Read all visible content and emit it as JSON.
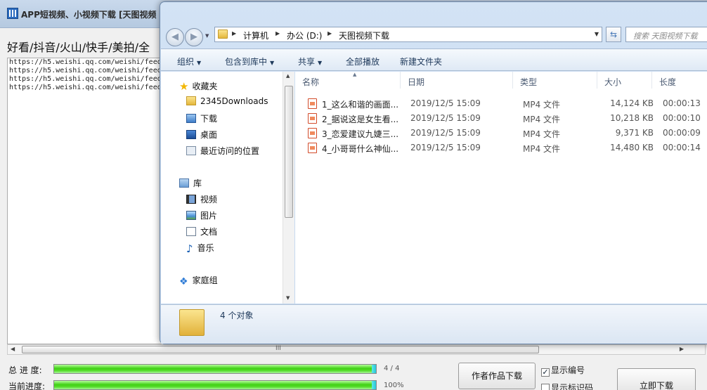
{
  "app": {
    "title": "APP短视频、小视频下载 [天图视频",
    "platforms": "好看/抖音/火山/快手/美拍/全",
    "urls": [
      "https://h5.weishi.qq.com/weishi/feed",
      "https://h5.weishi.qq.com/weishi/feed",
      "https://h5.weishi.qq.com/weishi/feed",
      "https://h5.weishi.qq.com/weishi/feed"
    ],
    "scroll_grip": "III",
    "total_label": "总 进 度:",
    "total_progress": 1.0,
    "total_text": "4 / 4",
    "current_label": "当前进度:",
    "current_progress": 1.0,
    "current_text": "100%",
    "author_button": "作者作品下载",
    "show_number_label": "显示编号",
    "show_number_checked": true,
    "show_marker_label": "显示标识码",
    "show_marker_checked": false,
    "download_button": "立即下载"
  },
  "explorer": {
    "breadcrumb": [
      "计算机",
      "办公 (D:)",
      "天图视频下载"
    ],
    "search_placeholder": "搜索 天图视频下载",
    "toolbar": [
      {
        "label": "组织",
        "dropdown": true
      },
      {
        "label": "包含到库中",
        "dropdown": true
      },
      {
        "label": "共享",
        "dropdown": true
      },
      {
        "label": "全部播放",
        "dropdown": false
      },
      {
        "label": "新建文件夹",
        "dropdown": false
      }
    ],
    "nav": {
      "favorites": "收藏夹",
      "fav_items": [
        "2345Downloads",
        "下载",
        "桌面",
        "最近访问的位置"
      ],
      "libraries": "库",
      "lib_items": [
        "视频",
        "图片",
        "文档",
        "音乐"
      ],
      "homegroup": "家庭组"
    },
    "columns": [
      "名称",
      "日期",
      "类型",
      "大小",
      "长度"
    ],
    "files": [
      {
        "name": "1_这么和谐的画面...",
        "date": "2019/12/5 15:09",
        "type": "MP4 文件",
        "size": "14,124 KB",
        "length": "00:00:13"
      },
      {
        "name": "2_据说这是女生看...",
        "date": "2019/12/5 15:09",
        "type": "MP4 文件",
        "size": "10,218 KB",
        "length": "00:00:10"
      },
      {
        "name": "3_恋爱建议九婕三...",
        "date": "2019/12/5 15:09",
        "type": "MP4 文件",
        "size": "9,371 KB",
        "length": "00:00:09"
      },
      {
        "name": "4_小哥哥什么神仙...",
        "date": "2019/12/5 15:09",
        "type": "MP4 文件",
        "size": "14,480 KB",
        "length": "00:00:14"
      }
    ],
    "status": "4 个对象",
    "colors": {
      "accent": "#1e395b",
      "file_icon": "#d24b2a",
      "progress": "#3fd014"
    }
  }
}
